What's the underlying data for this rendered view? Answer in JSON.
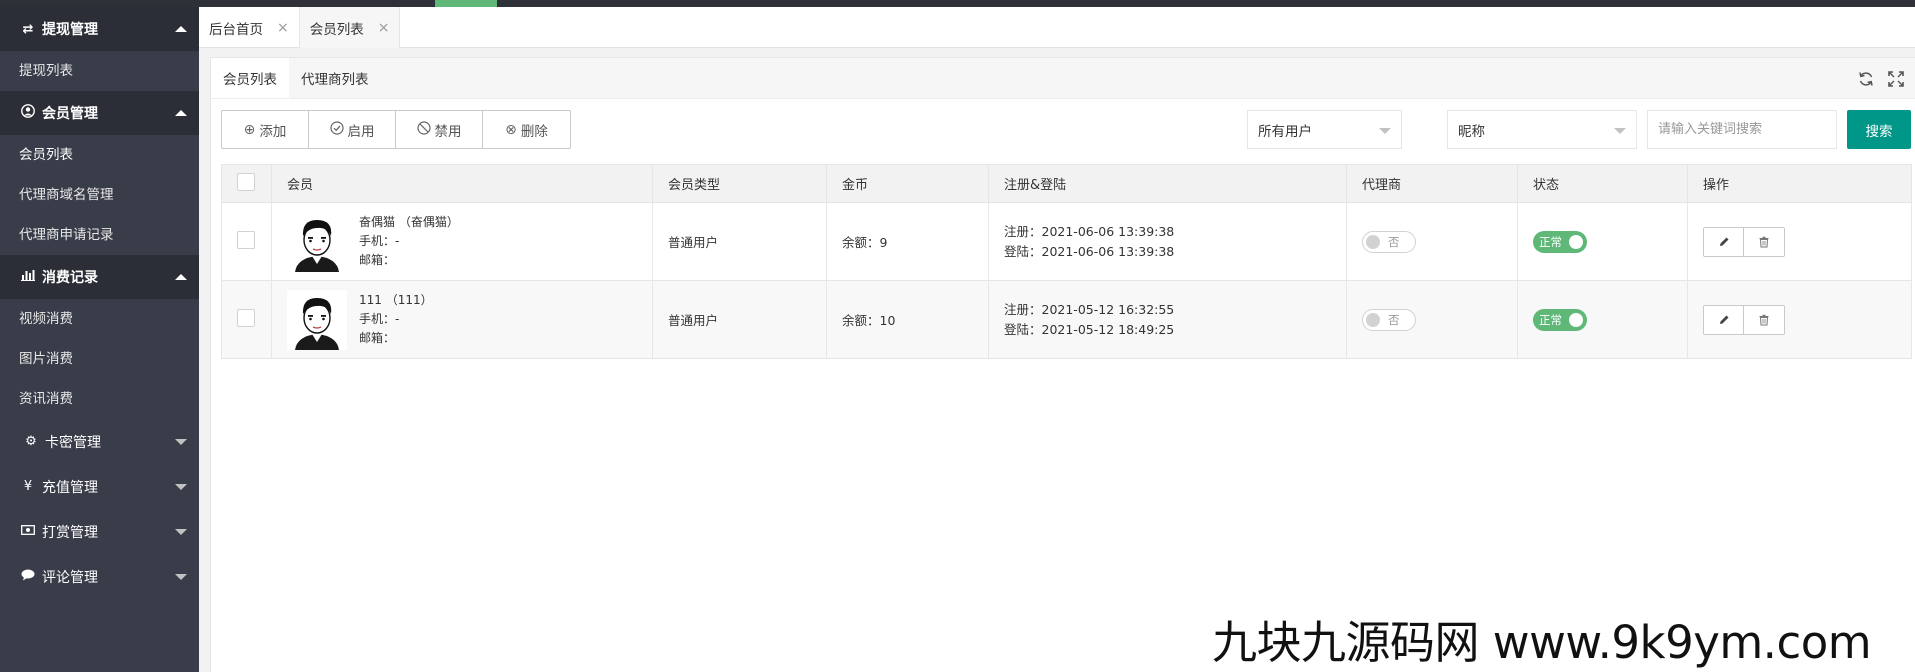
{
  "accent_color": "#5fb878",
  "primary_color": "#009688",
  "sidebar": {
    "groups": [
      {
        "icon": "transfer-icon",
        "label": "提现管理",
        "expanded": true,
        "items": [
          "提现列表"
        ]
      },
      {
        "icon": "user-circle-icon",
        "label": "会员管理",
        "expanded": true,
        "items": [
          "会员列表",
          "代理商域名管理",
          "代理商申请记录"
        ]
      },
      {
        "icon": "bar-chart-icon",
        "label": "消费记录",
        "expanded": true,
        "items": [
          "视频消费",
          "图片消费",
          "资讯消费"
        ]
      },
      {
        "icon": "gear-icon",
        "label": "卡密管理",
        "expanded": false,
        "items": []
      },
      {
        "icon": "yen-icon",
        "label": "充值管理",
        "expanded": false,
        "items": []
      },
      {
        "icon": "money-icon",
        "label": "打赏管理",
        "expanded": false,
        "items": []
      },
      {
        "icon": "comment-icon",
        "label": "评论管理",
        "expanded": false,
        "items": []
      }
    ],
    "active_item": "会员列表"
  },
  "tabs": [
    {
      "label": "后台首页",
      "active": false
    },
    {
      "label": "会员列表",
      "active": true
    }
  ],
  "subtabs": [
    {
      "label": "会员列表",
      "active": true
    },
    {
      "label": "代理商列表",
      "active": false
    }
  ],
  "toolbar": {
    "add_label": "添加",
    "enable_label": "启用",
    "disable_label": "禁用",
    "delete_label": "删除"
  },
  "filters": {
    "user_type_selected": "所有用户",
    "field_selected": "昵称",
    "search_placeholder": "请输入关键词搜索",
    "search_label": "搜索"
  },
  "table": {
    "headers": [
      "会员",
      "会员类型",
      "金币",
      "注册&登陆",
      "代理商",
      "状态",
      "操作"
    ],
    "rows": [
      {
        "name": "奋偶猫 （奋偶猫）",
        "phone": "手机：-",
        "email": "邮箱：",
        "type": "普通用户",
        "coins": "余额：9",
        "register": "注册：2021-06-06 13:39:38",
        "login": "登陆：2021-06-06 13:39:38",
        "agent": "否",
        "status": "正常"
      },
      {
        "name": "111 （111）",
        "phone": "手机：-",
        "email": "邮箱：",
        "type": "普通用户",
        "coins": "余额：10",
        "register": "注册：2021-05-12 16:32:55",
        "login": "登陆：2021-05-12 18:49:25",
        "agent": "否",
        "status": "正常"
      }
    ]
  },
  "watermark": "九块九源码网 www.9k9ym.com"
}
